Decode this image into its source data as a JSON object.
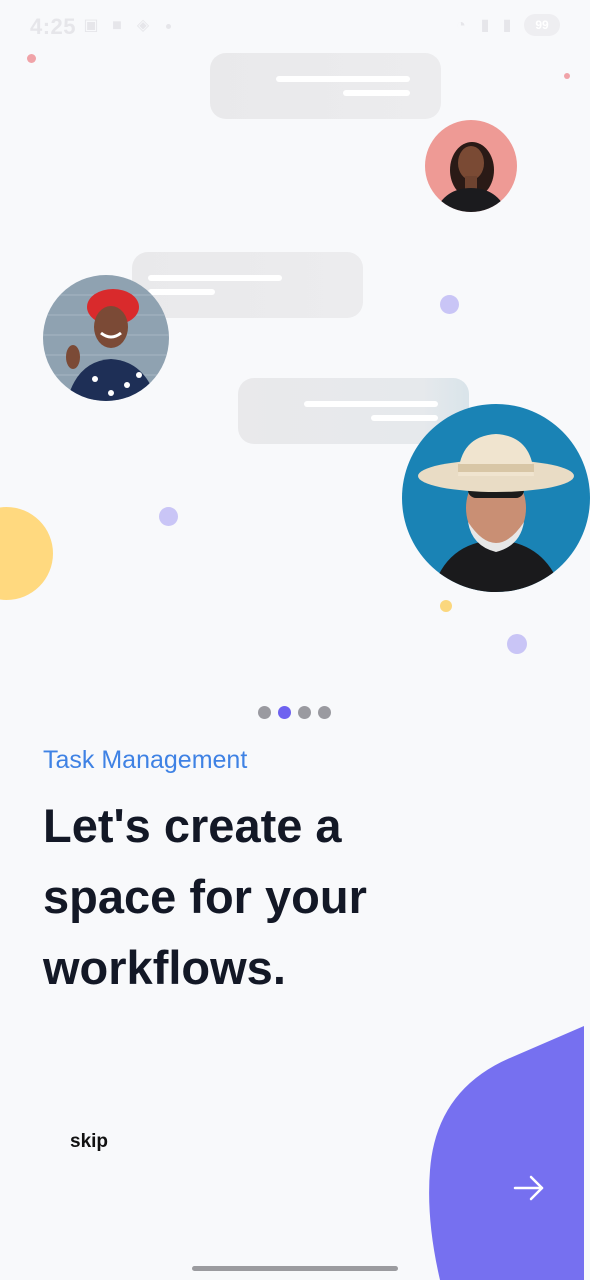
{
  "status_bar": {
    "time": "4:25",
    "battery": "99"
  },
  "onboarding": {
    "category": "Task Management",
    "headline_lines": [
      "Let's create a",
      "space for your",
      "workflows."
    ],
    "skip_label": "skip",
    "next_icon": "arrow-right-icon",
    "pager": {
      "total": 4,
      "active_index": 1
    }
  },
  "colors": {
    "accent": "#6e62f0",
    "category_text": "#3f82e4",
    "headline_text": "#131826",
    "background": "#f8f9fb",
    "blob": "#7670f0"
  }
}
